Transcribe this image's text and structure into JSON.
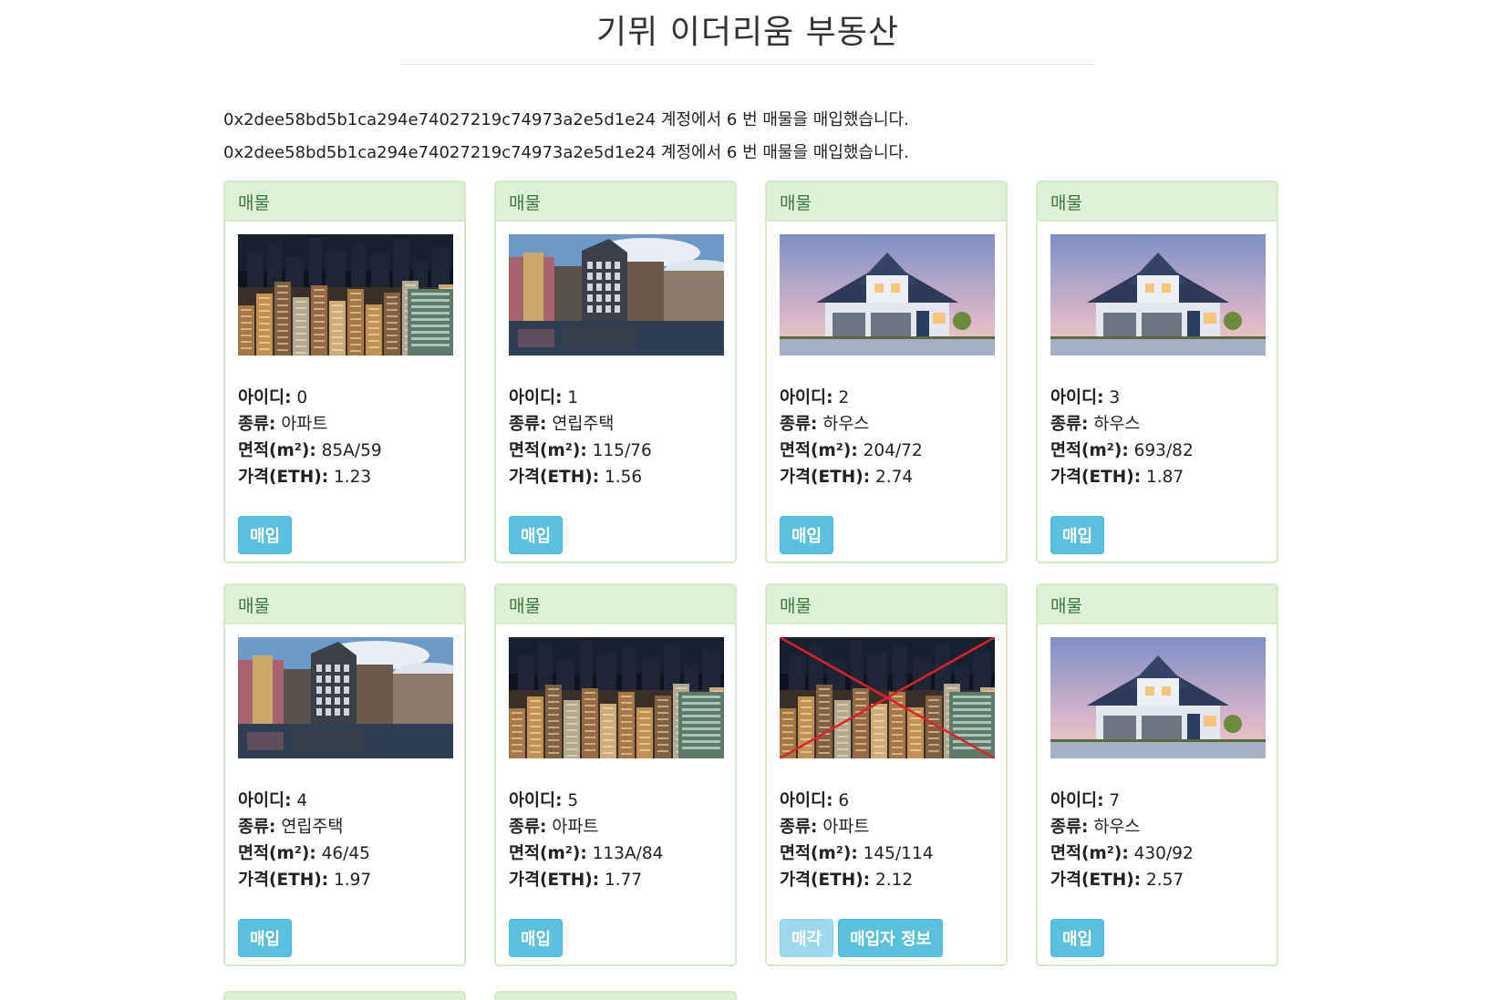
{
  "title": "기뮈 이더리움 부동산",
  "messages": [
    "0x2dee58bd5b1ca294e74027219c74973a2e5d1e24 계정에서 6 번 매물을 매입했습니다.",
    "0x2dee58bd5b1ca294e74027219c74973a2e5d1e24 계정에서 6 번 매물을 매입했습니다."
  ],
  "labels": {
    "id": "아이디",
    "type": "종류",
    "area": "면적(m²)",
    "price": "가격(ETH)"
  },
  "listings": [
    {
      "heading": "매물",
      "photo": "city-night-apartments-image",
      "sold": false,
      "id": "0",
      "type": "아파트",
      "area": "85A/59",
      "price": "1.23",
      "buttons": [
        "매입"
      ]
    },
    {
      "heading": "매물",
      "photo": "canal-houses-image",
      "sold": false,
      "id": "1",
      "type": "연립주택",
      "area": "115/76",
      "price": "1.56",
      "buttons": [
        "매입"
      ]
    },
    {
      "heading": "매물",
      "photo": "suburban-house-image",
      "sold": false,
      "id": "2",
      "type": "하우스",
      "area": "204/72",
      "price": "2.74",
      "buttons": [
        "매입"
      ]
    },
    {
      "heading": "매물",
      "photo": "suburban-house-image",
      "sold": false,
      "id": "3",
      "type": "하우스",
      "area": "693/82",
      "price": "1.87",
      "buttons": [
        "매입"
      ]
    },
    {
      "heading": "매물",
      "photo": "canal-houses-image",
      "sold": false,
      "id": "4",
      "type": "연립주택",
      "area": "46/45",
      "price": "1.97",
      "buttons": [
        "매입"
      ]
    },
    {
      "heading": "매물",
      "photo": "city-night-apartments-image",
      "sold": false,
      "id": "5",
      "type": "아파트",
      "area": "113A/84",
      "price": "1.77",
      "buttons": [
        "매입"
      ]
    },
    {
      "heading": "매물",
      "photo": "city-night-apartments-image",
      "sold": true,
      "id": "6",
      "type": "아파트",
      "area": "145/114",
      "price": "2.12",
      "buttons": [
        "매각",
        "매입자 정보"
      ]
    },
    {
      "heading": "매물",
      "photo": "suburban-house-image",
      "sold": false,
      "id": "7",
      "type": "하우스",
      "area": "430/92",
      "price": "2.57",
      "buttons": [
        "매입"
      ]
    }
  ],
  "colors": {
    "panel_heading_bg": "#dff0d8",
    "panel_heading_text": "#3c763d",
    "panel_border": "#d6e9c6",
    "button_info": "#5bc0de",
    "sold_cross": "#e0202a"
  }
}
